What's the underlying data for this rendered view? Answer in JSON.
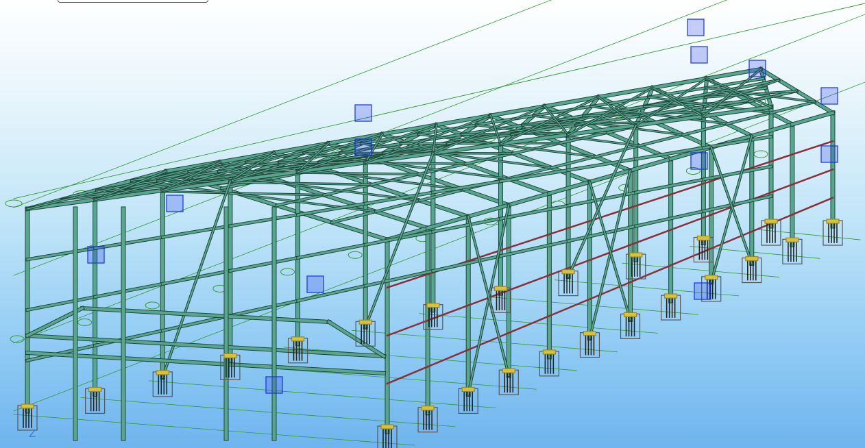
{
  "window": {
    "title": ""
  },
  "view_tab": {
    "label": ""
  },
  "axis": {
    "z_label": "Z"
  },
  "colors": {
    "steel": "#58a690",
    "steel_edge": "#1f4638",
    "grid": "#2f9b2f",
    "brace": "#8a2f3a",
    "connection": "#1630e0",
    "anchor": "#d8c040"
  },
  "model": {
    "frame_count": 12,
    "description_icon": "axis-triad-icon"
  }
}
